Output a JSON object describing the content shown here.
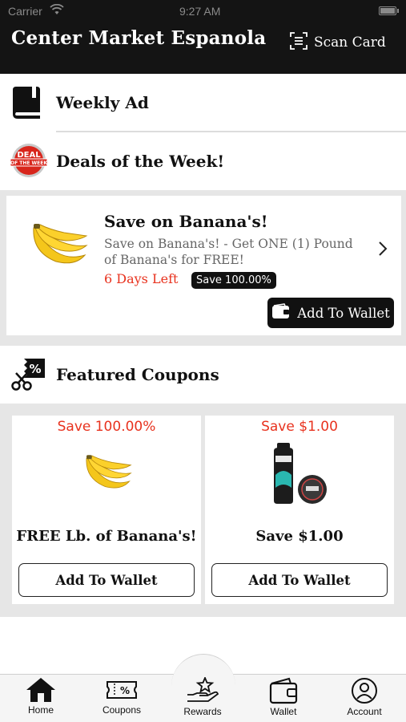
{
  "status_bar": {
    "carrier": "Carrier",
    "time": "9:27 AM"
  },
  "header": {
    "title": "Center Market Espanola",
    "scan_card_label": "Scan Card"
  },
  "sections": {
    "weekly_ad": "Weekly Ad",
    "deals": "Deals of the Week!",
    "featured": "Featured Coupons"
  },
  "deal": {
    "title": "Save on Banana's!",
    "description": "Save on Banana's! - Get ONE (1) Pound of Banana's for FREE!",
    "days_left": "6 Days Left",
    "save_badge": "Save 100.00%",
    "button_label": "Add To Wallet"
  },
  "coupons": [
    {
      "save": "Save 100.00%",
      "name": "FREE Lb. of Banana's!",
      "button": "Add To Wallet",
      "image": "bananas"
    },
    {
      "save": "Save $1.00",
      "name": "Save $1.00",
      "button": "Add To Wallet",
      "image": "axe-products"
    }
  ],
  "deal_badge_text": "DEAL OF THE WEEK",
  "tabs": [
    {
      "label": "Home",
      "icon": "home-icon"
    },
    {
      "label": "Coupons",
      "icon": "coupon-ticket-icon"
    },
    {
      "label": "Rewards",
      "icon": "rewards-hand-star-icon"
    },
    {
      "label": "Wallet",
      "icon": "wallet-icon"
    },
    {
      "label": "Account",
      "icon": "account-icon"
    }
  ],
  "colors": {
    "header_bg": "#141414",
    "accent_red": "#e8321e",
    "panel_gray": "#e6e6e6"
  }
}
